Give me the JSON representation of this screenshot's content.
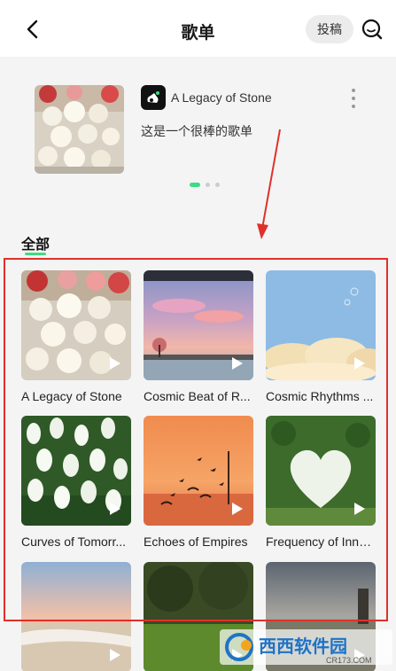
{
  "header": {
    "title": "歌单",
    "submit_label": "投稿"
  },
  "featured": {
    "name": "A Legacy of Stone",
    "description": "这是一个很棒的歌单"
  },
  "section": {
    "title": "全部"
  },
  "playlists": [
    {
      "title": "A Legacy of Stone"
    },
    {
      "title": "Cosmic Beat of R..."
    },
    {
      "title": "Cosmic Rhythms ..."
    },
    {
      "title": "Curves of Tomorr..."
    },
    {
      "title": "Echoes of Empires"
    },
    {
      "title": "Frequency of Inno..."
    },
    {
      "title": ""
    },
    {
      "title": ""
    },
    {
      "title": ""
    }
  ],
  "watermark": {
    "brand": "西西软件园",
    "url": "CR173.COM"
  },
  "colors": {
    "accent": "#3ddc84",
    "annotation": "#e0302a"
  }
}
